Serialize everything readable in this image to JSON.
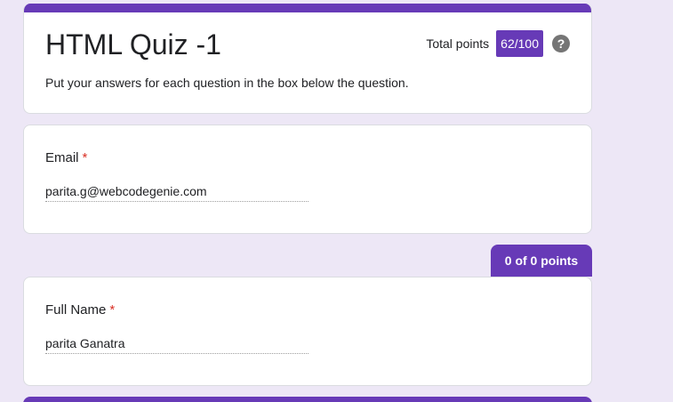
{
  "header": {
    "title": "HTML Quiz -1",
    "description": "Put your answers for each question in the box below the question.",
    "total_points_label": "Total points",
    "score": "62/100",
    "help_icon": "?"
  },
  "questions": [
    {
      "label": "Email",
      "required_mark": "*",
      "answer": "parita.g@webcodegenie.com"
    },
    {
      "label": "Full Name",
      "required_mark": "*",
      "answer": "parita Ganatra"
    }
  ],
  "section": {
    "points": "0 of 0 points"
  },
  "colors": {
    "accent": "#673ab7",
    "background": "#ede7f6",
    "required": "#d93025"
  }
}
